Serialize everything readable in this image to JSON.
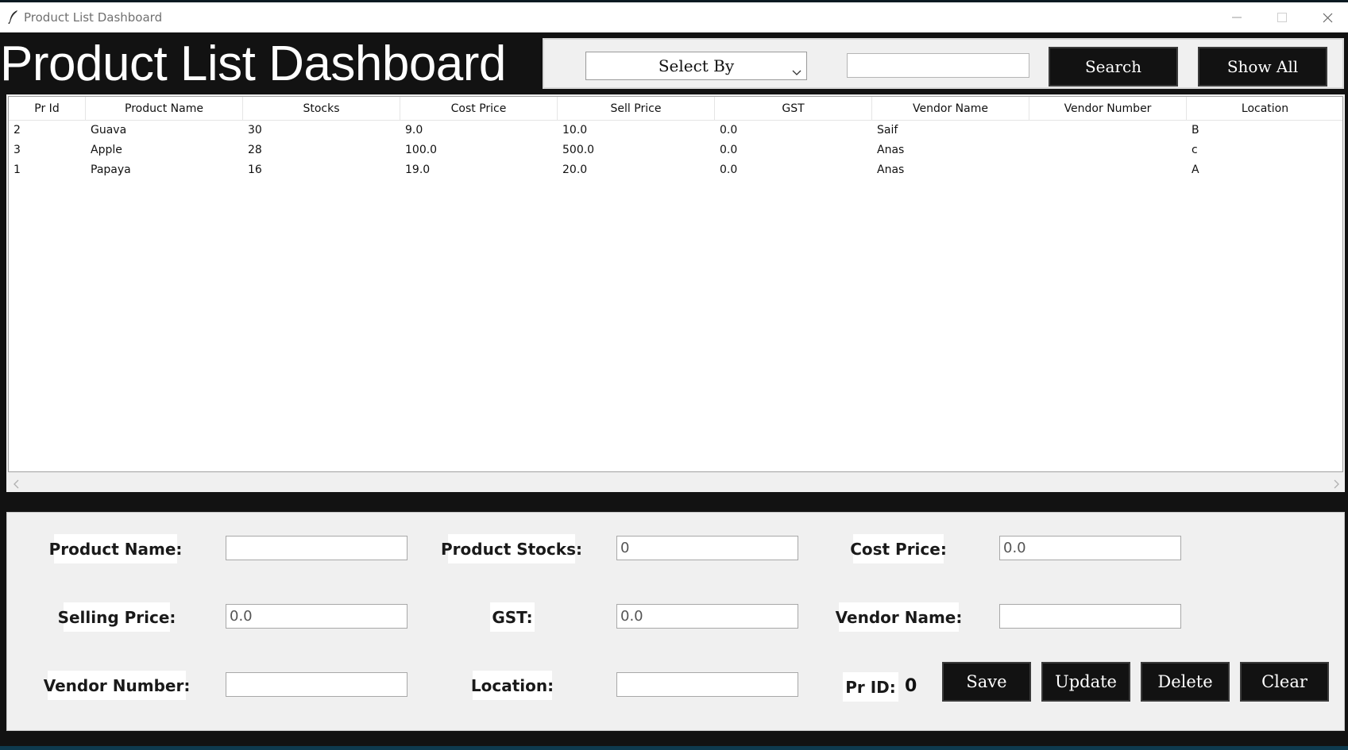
{
  "window": {
    "title": "Product List Dashboard",
    "minimize_icon": "minimize-icon",
    "maximize_icon": "maximize-icon",
    "close_icon": "close-icon"
  },
  "header": {
    "title": "Product List Dashboard"
  },
  "search": {
    "select_label": "Select By",
    "query_value": "",
    "search_label": "Search",
    "show_all_label": "Show All"
  },
  "table": {
    "columns": [
      "Pr Id",
      "Product Name",
      "Stocks",
      "Cost Price",
      "Sell Price",
      "GST",
      "Vendor Name",
      "Vendor Number",
      "Location"
    ],
    "rows": [
      [
        "2",
        "Guava",
        "30",
        "9.0",
        "10.0",
        "0.0",
        "Saif",
        "",
        "B"
      ],
      [
        "3",
        "Apple",
        "28",
        "100.0",
        "500.0",
        "0.0",
        "Anas",
        "",
        "c"
      ],
      [
        "1",
        "Papaya",
        "16",
        "19.0",
        "20.0",
        "0.0",
        "Anas",
        "",
        "A"
      ]
    ]
  },
  "form": {
    "product_name_label": "Product Name:",
    "product_name_value": "",
    "product_stocks_label": "Product Stocks:",
    "product_stocks_value": "0",
    "cost_price_label": "Cost Price:",
    "cost_price_value": "0.0",
    "selling_price_label": "Selling Price:",
    "selling_price_value": "0.0",
    "gst_label": "GST:",
    "gst_value": "0.0",
    "vendor_name_label": "Vendor Name:",
    "vendor_name_value": "",
    "vendor_number_label": "Vendor Number:",
    "vendor_number_value": "",
    "location_label": "Location:",
    "location_value": "",
    "pr_id_label": "Pr ID:",
    "pr_id_value": "0"
  },
  "actions": {
    "save": "Save",
    "update": "Update",
    "delete": "Delete",
    "clear": "Clear"
  },
  "colors": {
    "background": "#121212",
    "panel": "#f0f0f0",
    "button": "#121212",
    "button_text": "#ffffff"
  }
}
